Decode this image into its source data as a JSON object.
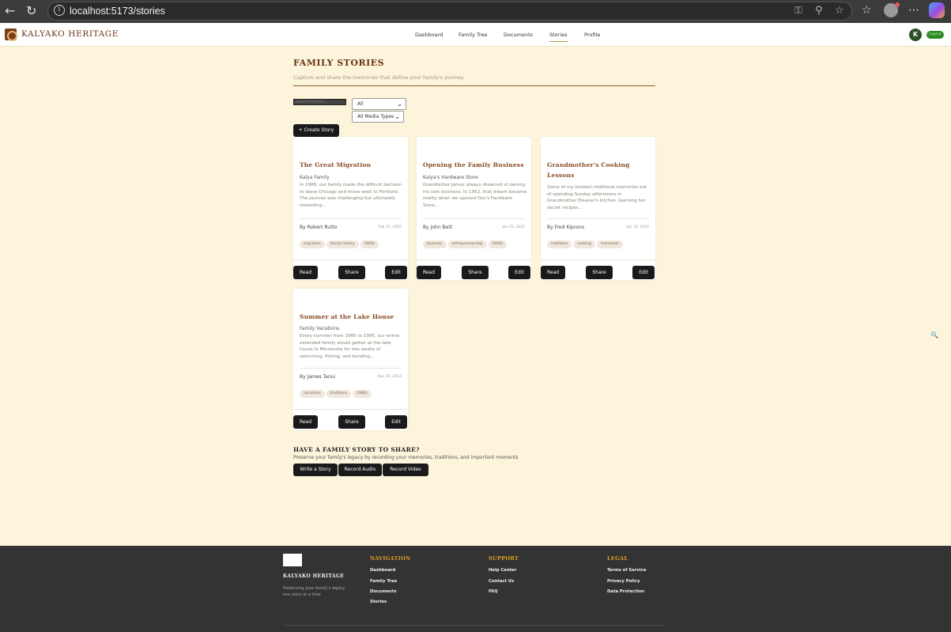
{
  "browser": {
    "url": "localhost:5173/stories"
  },
  "header": {
    "brand": "KALYAKO HERITAGE",
    "nav": [
      "Dashboard",
      "Family Tree",
      "Documents",
      "Stories",
      "Profile"
    ],
    "active_nav": "Stories",
    "avatar_initial": "K",
    "logout_label": "Logout"
  },
  "page": {
    "title": "FAMILY STORIES",
    "subtitle": "Capture and share the memories that define your family's journey"
  },
  "filters": {
    "search_placeholder": "Search stories...",
    "category_selected": "All",
    "media_selected": "All Media Types",
    "create_label": "+ Create Story"
  },
  "stories": [
    {
      "type": "text",
      "title": "The Great Migration",
      "family": "Kalya Family",
      "excerpt": "In 1968, our family made the difficult decision to leave Chicago and move west to Portland. The journey was challenging but ultimately rewarding...",
      "author": "By Robert Rutto",
      "date": "Feb 15, 2025",
      "tags": [
        "migration",
        "family history",
        "1960s"
      ]
    },
    {
      "type": "text",
      "title": "Opening the Family Business",
      "family": "Kalya's Hardware Store",
      "excerpt": "Grandfather James always dreamed of owning his own business. In 1952, that dream became reality when we opened Doc's Hardware Store...",
      "author": "By John Bett",
      "date": "Jan 25, 2025",
      "tags": [
        "business",
        "entrepreneurship",
        "1950s"
      ]
    },
    {
      "type": "audio",
      "title": "Grandmother's Cooking Lessons",
      "family": "",
      "excerpt": "Some of my fondest childhood memories are of spending Sunday afternoons in Grandmother Eleanor's kitchen, learning her secret recipes...",
      "author": "By Fred Kiprono",
      "date": "Jan 10, 2025",
      "tags": [
        "traditions",
        "cooking",
        "memories"
      ]
    },
    {
      "type": "video",
      "title": "Summer at the Lake House",
      "family": "Family Vacations",
      "excerpt": "Every summer from 1985 to 1995, our entire extended family would gather at the lake house in Minnesota for two weeks of swimming, fishing, and bonding...",
      "author": "By James Tanui",
      "date": "Dec 20, 2024",
      "tags": [
        "vacations",
        "traditions",
        "1980s"
      ]
    }
  ],
  "card_actions": {
    "read": "Read",
    "share": "Share",
    "edit": "Edit"
  },
  "cta": {
    "title": "HAVE A FAMILY STORY TO SHARE?",
    "subtitle": "Preserve your family's legacy by recording your memories, traditions, and important moments",
    "write": "Write a Story",
    "audio": "Record Audio",
    "video": "Record Video"
  },
  "footer": {
    "brand": "KALYAKO HERITAGE",
    "tagline": "Preserving your family's legacy, one story at a time",
    "columns": [
      {
        "heading": "NAVIGATION",
        "links": [
          "Dashboard",
          "Family Tree",
          "Documents",
          "Stories"
        ]
      },
      {
        "heading": "SUPPORT",
        "links": [
          "Help Center",
          "Contact Us",
          "FAQ"
        ]
      },
      {
        "heading": "LEGAL",
        "links": [
          "Terms of Service",
          "Privacy Policy",
          "Data Protection"
        ]
      }
    ]
  },
  "icons": {
    "text": "document-icon",
    "audio": "microphone-icon",
    "video": "film-icon"
  },
  "colors": {
    "page_bg": "#fcf5dc",
    "brand_brown": "#6a3415",
    "card_title": "#8a4a22",
    "button_dark": "#1a1a1a",
    "footer_bg": "#333333",
    "footer_heading": "#e0a020",
    "logout_green": "#2f8a25"
  }
}
